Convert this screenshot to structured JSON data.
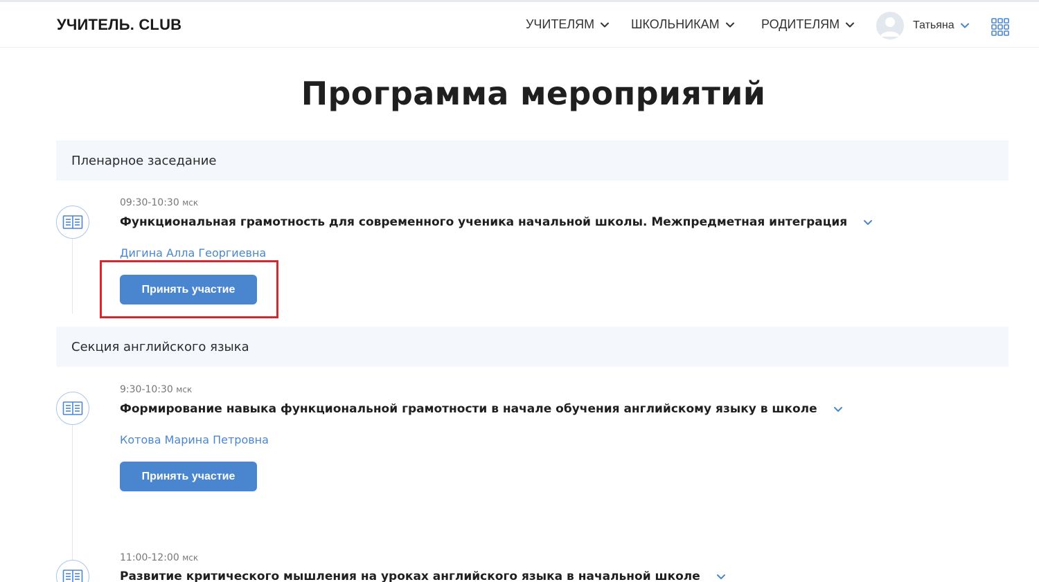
{
  "header": {
    "logo": "УЧИТЕЛЬ. CLUB",
    "nav": [
      "УЧИТЕЛЯМ",
      "ШКОЛЬНИКАМ",
      "РОДИТЕЛЯМ"
    ],
    "user_name": "Татьяна",
    "icons": {
      "chevron": "chevron-down-icon",
      "avatar": "user-avatar-icon",
      "apps": "apps-grid-icon"
    }
  },
  "page": {
    "title": "Программа мероприятий"
  },
  "sections": [
    {
      "title": "Пленарное заседание",
      "events": [
        {
          "time": "09:30-10:30",
          "tz": "мск",
          "title": "Функциональная грамотность для современного ученика начальной школы. Межпредметная интеграция",
          "speaker": "Дигина Алла Георгиевна",
          "button": "Принять участие"
        }
      ]
    },
    {
      "title": "Секция английского языка",
      "events": [
        {
          "time": "9:30-10:30",
          "tz": "мск",
          "title": "Формирование навыка функциональной грамотности в начале обучения английскому языку в школе",
          "speaker": "Котова Марина Петровна",
          "button": "Принять участие"
        },
        {
          "time": "11:00-12:00",
          "tz": "мск",
          "title": "Развитие критического мышления на уроках английского языка в начальной школе"
        }
      ]
    }
  ],
  "colors": {
    "accent": "#4a86d0",
    "section_bg": "#f4f7fb",
    "highlight": "#d9262c",
    "icon_ring": "#a9c6e8"
  }
}
